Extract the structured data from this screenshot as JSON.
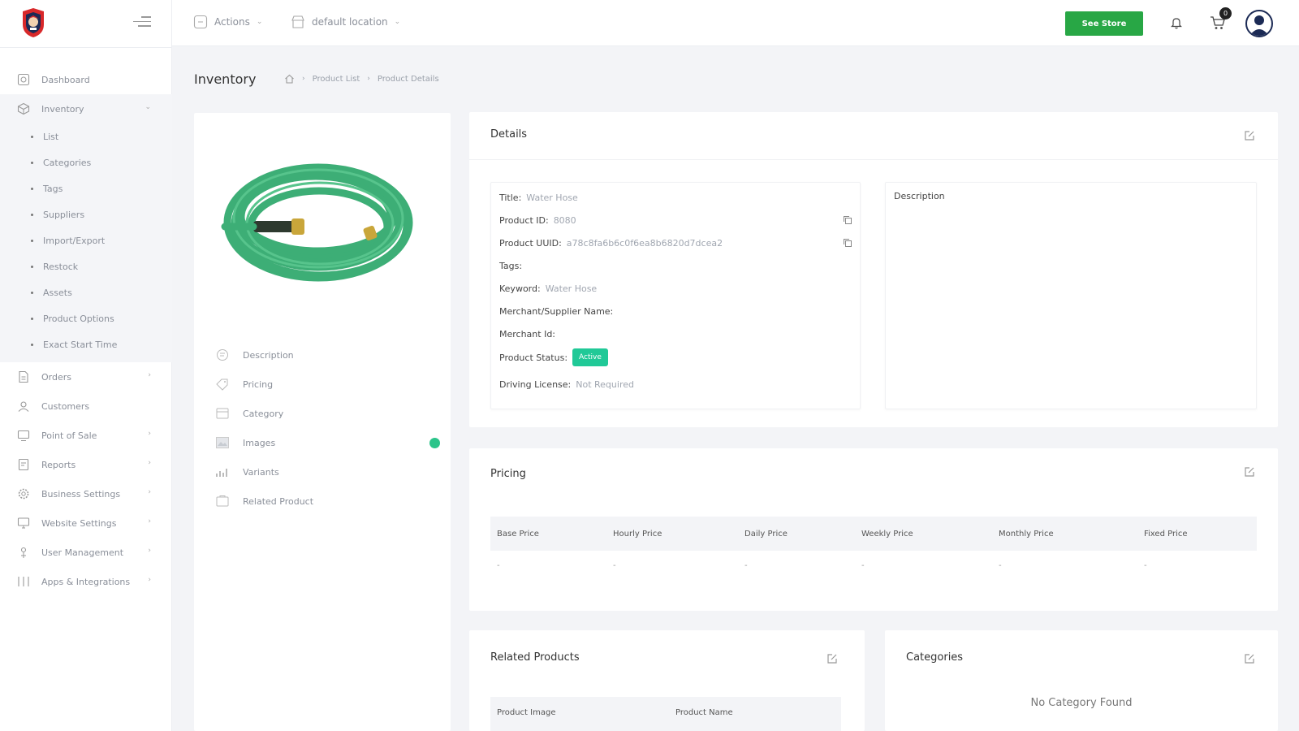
{
  "colors": {
    "accent_green": "#28a745",
    "status_teal": "#20c997",
    "dot_green": "#2bc48a",
    "avatar_navy": "#1b2a55"
  },
  "sidebar": {
    "logo_icon": "mascot-logo",
    "collapse_icon": "menu-collapse-icon",
    "items": [
      {
        "label": "Dashboard",
        "icon": "dashboard-icon",
        "has_chevron": false
      },
      {
        "label": "Inventory",
        "icon": "inventory-icon",
        "has_chevron": true,
        "expanded": true
      },
      {
        "label": "Orders",
        "icon": "orders-icon",
        "has_chevron": true
      },
      {
        "label": "Customers",
        "icon": "customers-icon",
        "has_chevron": false
      },
      {
        "label": "Point of Sale",
        "icon": "pos-icon",
        "has_chevron": true
      },
      {
        "label": "Reports",
        "icon": "reports-icon",
        "has_chevron": true
      },
      {
        "label": "Business Settings",
        "icon": "gear-icon",
        "has_chevron": true
      },
      {
        "label": "Website Settings",
        "icon": "monitor-icon",
        "has_chevron": true
      },
      {
        "label": "User Management",
        "icon": "user-icon",
        "has_chevron": true
      },
      {
        "label": "Apps & Integrations",
        "icon": "grid-icon",
        "has_chevron": true
      }
    ],
    "inventory_sub": [
      "List",
      "Categories",
      "Tags",
      "Suppliers",
      "Import/Export",
      "Restock",
      "Assets",
      "Product Options",
      "Exact Start Time"
    ]
  },
  "topbar": {
    "actions_label": "Actions",
    "location_label": "default location",
    "see_store_label": "See Store",
    "cart_count": "0"
  },
  "header": {
    "title": "Inventory",
    "breadcrumb": [
      "Product List",
      "Product Details"
    ]
  },
  "product_tabs": [
    "Description",
    "Pricing",
    "Category",
    "Images",
    "Variants",
    "Related Product"
  ],
  "details": {
    "title": "Details",
    "rows": {
      "title_label": "Title:",
      "title_value": "Water Hose",
      "id_label": "Product ID:",
      "id_value": "8080",
      "uuid_label": "Product UUID:",
      "uuid_value": "a78c8fa6b6c0f6ea8b6820d7dcea2",
      "tags_label": "Tags:",
      "keyword_label": "Keyword:",
      "keyword_value": "Water Hose",
      "merchant_label": "Merchant/Supplier Name:",
      "merchant_id_label": "Merchant Id:",
      "status_label": "Product Status:",
      "status_value": "Active",
      "license_label": "Driving License:",
      "license_value": "Not Required"
    },
    "description_label": "Description"
  },
  "pricing": {
    "title": "Pricing",
    "columns": [
      "Base Price",
      "Hourly Price",
      "Daily Price",
      "Weekly Price",
      "Monthly Price",
      "Fixed Price"
    ],
    "values": [
      "-",
      "-",
      "-",
      "-",
      "-",
      "-"
    ]
  },
  "related": {
    "title": "Related Products",
    "columns": [
      "Product Image",
      "Product Name"
    ]
  },
  "categories": {
    "title": "Categories",
    "empty_text": "No Category Found"
  }
}
